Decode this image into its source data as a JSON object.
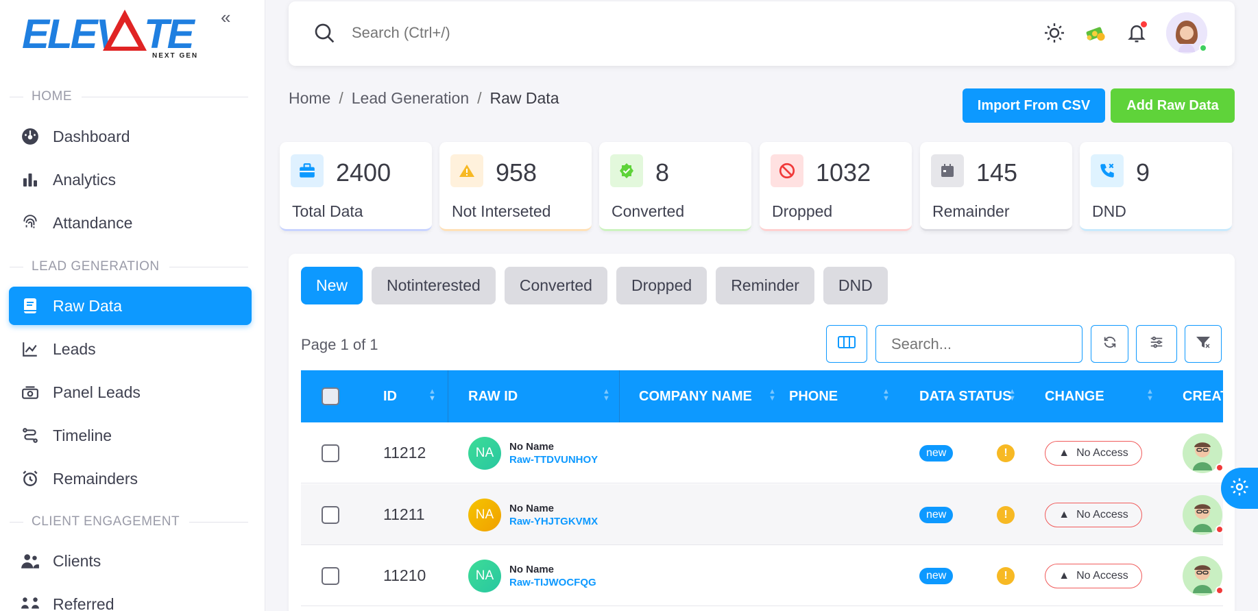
{
  "brand": {
    "logo_text": "ELEVATE",
    "logo_sub": "NEXT GEN",
    "accent": "#0d99ff",
    "green": "#5fd33a"
  },
  "sidebar": {
    "sections": [
      {
        "label": "HOME"
      },
      {
        "label": "LEAD GENERATION"
      },
      {
        "label": "CLIENT ENGAGEMENT"
      }
    ],
    "items": [
      {
        "label": "Dashboard",
        "icon": "dashboard-icon"
      },
      {
        "label": "Analytics",
        "icon": "bar-chart-icon"
      },
      {
        "label": "Attandance",
        "icon": "fingerprint-icon"
      },
      {
        "label": "Raw Data",
        "icon": "book-icon",
        "active": true
      },
      {
        "label": "Leads",
        "icon": "line-chart-icon"
      },
      {
        "label": "Panel Leads",
        "icon": "money-icon"
      },
      {
        "label": "Timeline",
        "icon": "route-icon"
      },
      {
        "label": "Remainders",
        "icon": "alarm-icon"
      },
      {
        "label": "Clients",
        "icon": "users-icon"
      },
      {
        "label": "Referred",
        "icon": "referral-icon"
      }
    ]
  },
  "topbar": {
    "search_placeholder": "Search (Ctrl+/)"
  },
  "breadcrumb": {
    "home": "Home",
    "section": "Lead Generation",
    "current": "Raw Data",
    "separator": "/"
  },
  "actions": {
    "import_label": "Import From CSV",
    "add_label": "Add Raw Data"
  },
  "stats": [
    {
      "value": "2400",
      "label": "Total Data",
      "icon": "briefcase-icon",
      "color": "#0d99ff"
    },
    {
      "value": "958",
      "label": "Not Interseted",
      "icon": "warning-icon",
      "color": "#f7b924"
    },
    {
      "value": "8",
      "label": "Converted",
      "icon": "check-badge-icon",
      "color": "#5fd33a"
    },
    {
      "value": "1032",
      "label": "Dropped",
      "icon": "ban-icon",
      "color": "#f05a5a"
    },
    {
      "value": "145",
      "label": "Remainder",
      "icon": "calendar-icon",
      "color": "#6b6c78"
    },
    {
      "value": "9",
      "label": "DND",
      "icon": "phone-x-icon",
      "color": "#0d99ff"
    }
  ],
  "tabs": [
    {
      "label": "New",
      "active": true
    },
    {
      "label": "Notinterested"
    },
    {
      "label": "Converted"
    },
    {
      "label": "Dropped"
    },
    {
      "label": "Reminder"
    },
    {
      "label": "DND"
    }
  ],
  "table": {
    "page_info": "Page 1 of 1",
    "search_placeholder": "Search...",
    "columns": [
      "ID",
      "RAW ID",
      "COMPANY NAME",
      "PHONE",
      "DATA STATUS",
      "CHANGE",
      "CREAT"
    ],
    "rows": [
      {
        "id": "11212",
        "initials": "NA",
        "name": "No Name",
        "raw_id": "Raw-TTDVUNHOY",
        "status": "new",
        "change": "No Access",
        "color": "#3ddc97"
      },
      {
        "id": "11211",
        "initials": "NA",
        "name": "No Name",
        "raw_id": "Raw-YHJTGKVMX",
        "status": "new",
        "change": "No Access",
        "color": "#f5b400"
      },
      {
        "id": "11210",
        "initials": "NA",
        "name": "No Name",
        "raw_id": "Raw-TIJWOCFQG",
        "status": "new",
        "change": "No Access",
        "color": "#3ddc97"
      }
    ]
  }
}
